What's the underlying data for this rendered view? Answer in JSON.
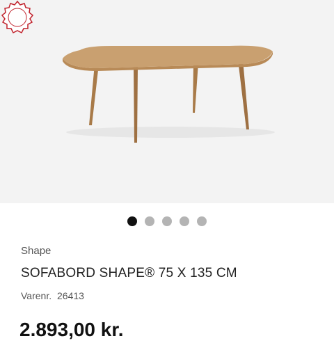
{
  "gallery": {
    "image_alt": "Sofabord Shape 75 x 135 cm",
    "badge_icon": "guarantee-seal-icon",
    "badge_color": "#c0202a",
    "dots_total": 5,
    "active_dot": 0
  },
  "product": {
    "brand": "Shape",
    "title": "SOFABORD SHAPE® 75 X 135 CM",
    "sku_label": "Varenr.",
    "sku_value": "26413",
    "price": "2.893,00 kr."
  }
}
